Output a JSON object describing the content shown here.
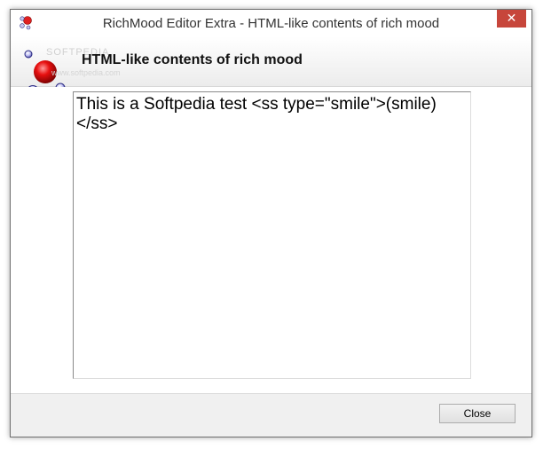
{
  "window": {
    "title": "RichMood Editor Extra - HTML-like contents of rich mood",
    "close_glyph": "✕",
    "close_color": "#c7463b"
  },
  "header": {
    "heading": "HTML-like contents of rich mood",
    "logo_icon": "richmood-bubbles-icon",
    "watermark": "SOFTPEDIA",
    "watermark_url": "www.softpedia.com"
  },
  "editor": {
    "content": "This is a Softpedia test <ss type=\"smile\">(smile)</ss>"
  },
  "footer": {
    "close_label": "Close"
  }
}
